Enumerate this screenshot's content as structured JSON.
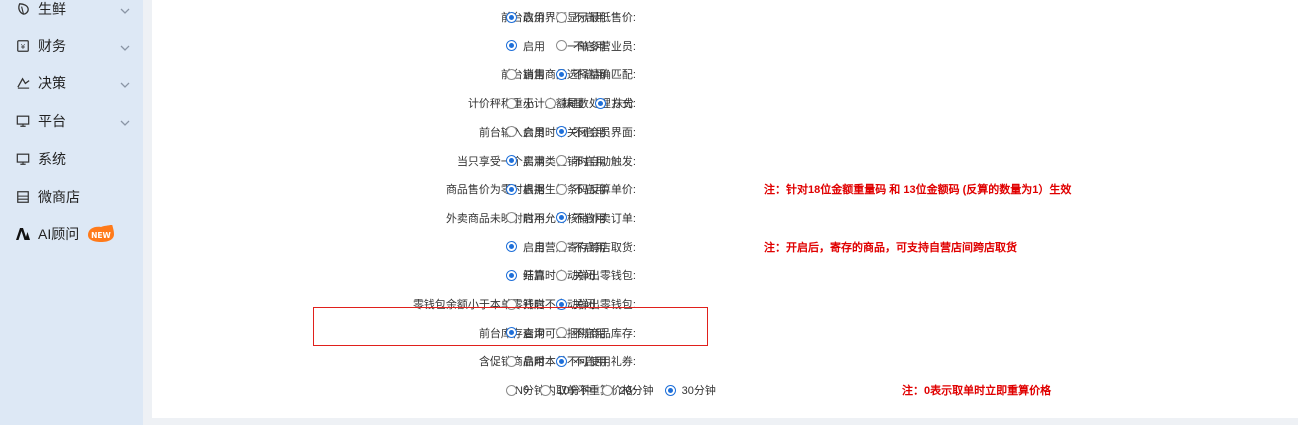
{
  "sidebar": {
    "items": [
      {
        "label": "生鲜",
        "icon": "leaf-icon",
        "has_chevron": true
      },
      {
        "label": "财务",
        "icon": "finance-icon",
        "has_chevron": true
      },
      {
        "label": "决策",
        "icon": "decision-icon",
        "has_chevron": true
      },
      {
        "label": "平台",
        "icon": "monitor-icon",
        "has_chevron": true
      },
      {
        "label": "系统",
        "icon": "monitor-icon",
        "has_chevron": false
      },
      {
        "label": "微商店",
        "icon": "store-icon",
        "has_chevron": false
      },
      {
        "label": "AI顾问",
        "icon": "ai-icon",
        "has_chevron": false,
        "badge": "NEW"
      }
    ]
  },
  "settings": [
    {
      "label": "前台改价界面显示最低售价:",
      "options": [
        "启用",
        "不启用"
      ],
      "selected": 0
    },
    {
      "label": "一单多营业员:",
      "options": [
        "启用",
        "不启用"
      ],
      "selected": 0
    },
    {
      "label": "前台销售商品选择精确匹配:",
      "options": [
        "启用",
        "不启用"
      ],
      "selected": 1
    },
    {
      "label": "计价秤称重小计金额尾数处理方式:",
      "options": [
        "无",
        "抹厘",
        "抹分"
      ],
      "selected": 2
    },
    {
      "label": "前台输入会员时不关闭会员界面:",
      "options": [
        "启用",
        "不启用"
      ],
      "selected": 1
    },
    {
      "label": "当只享受一个买满类促销时自动触发:",
      "options": [
        "启用",
        "不启用"
      ],
      "selected": 0
    },
    {
      "label": "商品售价为零时根据生鲜条码反算单价:",
      "options": [
        "启用",
        "不启用"
      ],
      "selected": 0,
      "note": "注：针对18位金额重量码 和 13位金额码 (反算的数量为1）生效"
    },
    {
      "label": "外卖商品未映射时不允许核销外卖订单:",
      "options": [
        "启用",
        "不启用"
      ],
      "selected": 1
    },
    {
      "label": "自营店寄存跨店取货:",
      "options": [
        "启用",
        "不启用"
      ],
      "selected": 0,
      "note": "注：开启后，寄存的商品，可支持自营店间跨店取货"
    },
    {
      "label": "结算时自动弹出零钱包:",
      "options": [
        "开启",
        "关闭"
      ],
      "selected": 0
    },
    {
      "label": "零钱包余额小于本单零钱时不自动弹出零钱包:",
      "options": [
        "开启",
        "关闭"
      ],
      "selected": 1
    },
    {
      "label": "前台库存查询可查捆绑商品库存:",
      "options": [
        "启用",
        "不启用"
      ],
      "selected": 0
    },
    {
      "label": "含促销商品时本单不可使用礼券:",
      "options": [
        "启用",
        "不启用"
      ],
      "selected": 1
    },
    {
      "label": "N分钟内取单不重算价格:",
      "options": [
        "0",
        "10分钟",
        "20分钟",
        "30分钟"
      ],
      "selected": 3,
      "note": "注：0表示取单时立即重算价格"
    }
  ],
  "colors": {
    "accent": "#1e6fd9",
    "note": "#e00000",
    "highlight": "#e0201c",
    "sidebar_bg": "#dde8f5"
  }
}
